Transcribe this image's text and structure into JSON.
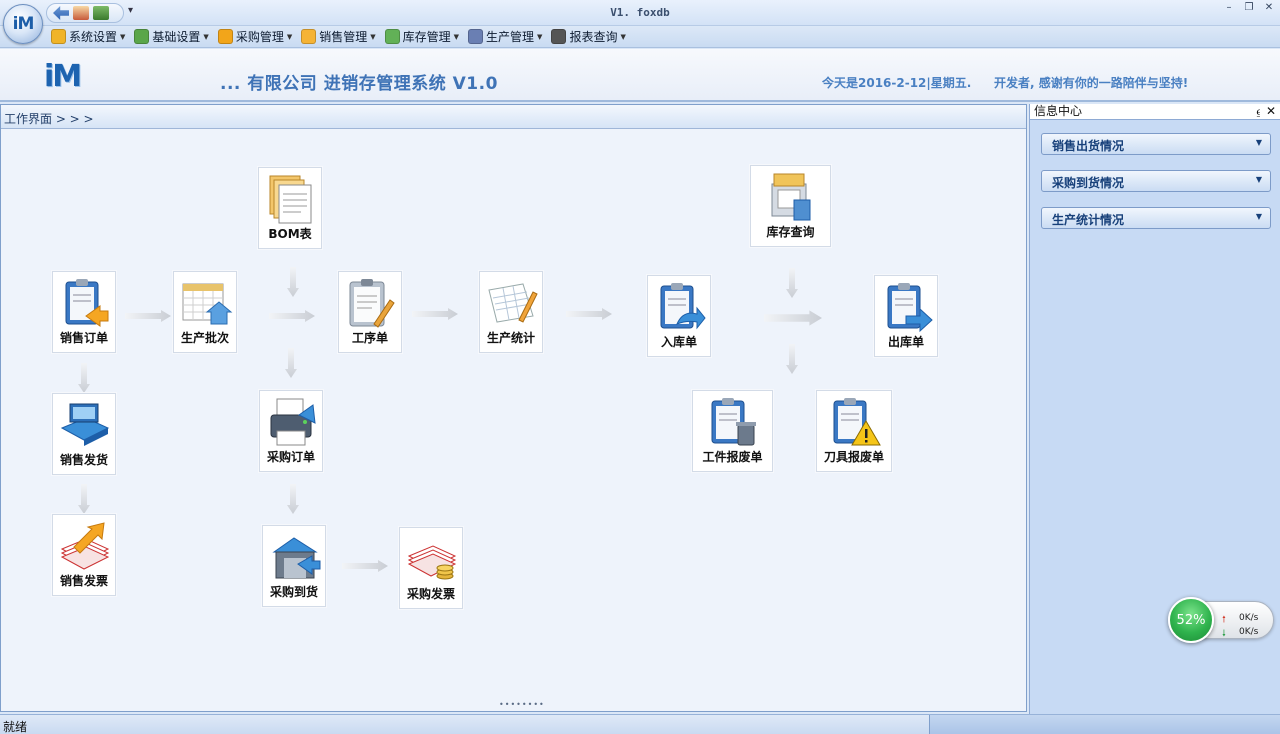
{
  "window": {
    "title": "V1. foxdb",
    "orb_label": "iM"
  },
  "menu": [
    {
      "label": "系统设置",
      "icon": "gear-star-icon",
      "color": "#f0b429"
    },
    {
      "label": "基础设置",
      "icon": "pencil-list-icon",
      "color": "#5aa64a"
    },
    {
      "label": "采购管理",
      "icon": "cart-icon",
      "color": "#f2a51a"
    },
    {
      "label": "销售管理",
      "icon": "sales-tag-icon",
      "color": "#f5b335"
    },
    {
      "label": "库存管理",
      "icon": "warehouse-icon",
      "color": "#62b157"
    },
    {
      "label": "生产管理",
      "icon": "tools-icon",
      "color": "#6a7fb3"
    },
    {
      "label": "报表查询",
      "icon": "report-eye-icon",
      "color": "#555555"
    }
  ],
  "banner": {
    "logo": "iM",
    "company_title": "... 有限公司    进销存管理系统  V1.0",
    "date_text": "今天是2016-2-12|星期五.",
    "thanks_text": "开发者, 感谢有你的一路陪伴与坚持!"
  },
  "workspace": {
    "header": "工作界面 > > >",
    "nodes": [
      {
        "id": "bom",
        "label": "BOM表",
        "icon": "bom-documents-icon"
      },
      {
        "id": "sales_order",
        "label": "销售订单",
        "icon": "clipboard-arrow-icon"
      },
      {
        "id": "prod_batch",
        "label": "生产批次",
        "icon": "calendar-house-icon"
      },
      {
        "id": "process_order",
        "label": "工序单",
        "icon": "clipboard-pen-icon"
      },
      {
        "id": "prod_stats",
        "label": "生产统计",
        "icon": "spreadsheet-pen-icon"
      },
      {
        "id": "inbound",
        "label": "入库单",
        "icon": "clipboard-return-icon"
      },
      {
        "id": "stock_query",
        "label": "库存查询",
        "icon": "inventory-box-icon"
      },
      {
        "id": "outbound",
        "label": "出库单",
        "icon": "clipboard-out-icon"
      },
      {
        "id": "sales_ship",
        "label": "销售发货",
        "icon": "computer-delivery-icon"
      },
      {
        "id": "purchase_order",
        "label": "采购订单",
        "icon": "printer-order-icon"
      },
      {
        "id": "part_scrap",
        "label": "工件报废单",
        "icon": "clipboard-trash-icon"
      },
      {
        "id": "tool_scrap",
        "label": "刀具报废单",
        "icon": "clipboard-warning-icon"
      },
      {
        "id": "sales_invoice",
        "label": "销售发票",
        "icon": "invoice-arrow-icon"
      },
      {
        "id": "purchase_arrival",
        "label": "采购到货",
        "icon": "warehouse-arrival-icon"
      },
      {
        "id": "purchase_invoice",
        "label": "采购发票",
        "icon": "invoice-coins-icon"
      }
    ]
  },
  "info_panel": {
    "title": "信息中心",
    "sections": [
      "销售出货情况",
      "采购到货情况",
      "生产统计情况"
    ]
  },
  "status": {
    "text": "就绪"
  },
  "network": {
    "percent": "52%",
    "upload": "0K/s",
    "download": "0K/s"
  }
}
